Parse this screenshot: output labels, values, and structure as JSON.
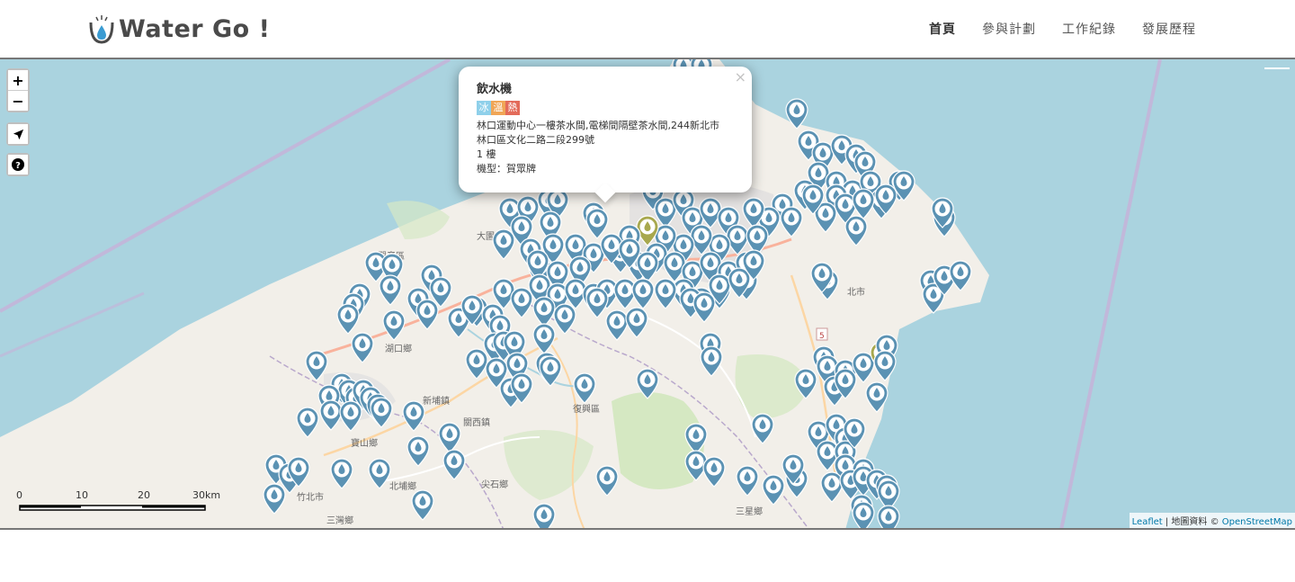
{
  "header": {
    "logo_text": "Water Go !",
    "nav": [
      {
        "label": "首頁",
        "active": true
      },
      {
        "label": "參與計劃",
        "active": false
      },
      {
        "label": "工作紀錄",
        "active": false
      },
      {
        "label": "發展歷程",
        "active": false
      }
    ]
  },
  "map_controls": {
    "zoom_in": "+",
    "zoom_out": "−",
    "locate_icon": "location-arrow-icon",
    "help_icon": "question-circle-icon"
  },
  "popup": {
    "title": "飲水機",
    "close": "×",
    "badges": [
      {
        "label": "冰",
        "color": "#8fd0ea"
      },
      {
        "label": "溫",
        "color": "#f0a657"
      },
      {
        "label": "熱",
        "color": "#e36b5a"
      }
    ],
    "address_line1": "林口運動中心一樓茶水間,電梯間隔壁茶水間,244新北市",
    "address_line2": "林口區文化二路二段299號",
    "floor": "1 樓",
    "model": "機型：賀眾牌"
  },
  "scale_bar": {
    "labels": [
      "0",
      "10",
      "20",
      "30km"
    ]
  },
  "attribution": {
    "leaflet": "Leaflet",
    "separator": " | 地圖資料 © ",
    "osm": "OpenStreetMap"
  },
  "map_labels": {
    "place_names": [
      "大園",
      "觀音區",
      "湖口鄉",
      "新埔鎮",
      "寶山鄉",
      "竹北市",
      "北埔鄉",
      "三灣鄉",
      "關西鎮",
      "尖石鄉",
      "復興區",
      "三星鄉",
      "北市",
      "5"
    ]
  },
  "colors": {
    "sea": "#aad3df",
    "land": "#f2efe9",
    "marker_blue": "#5b92b3",
    "marker_olive": "#a8a84e"
  }
}
